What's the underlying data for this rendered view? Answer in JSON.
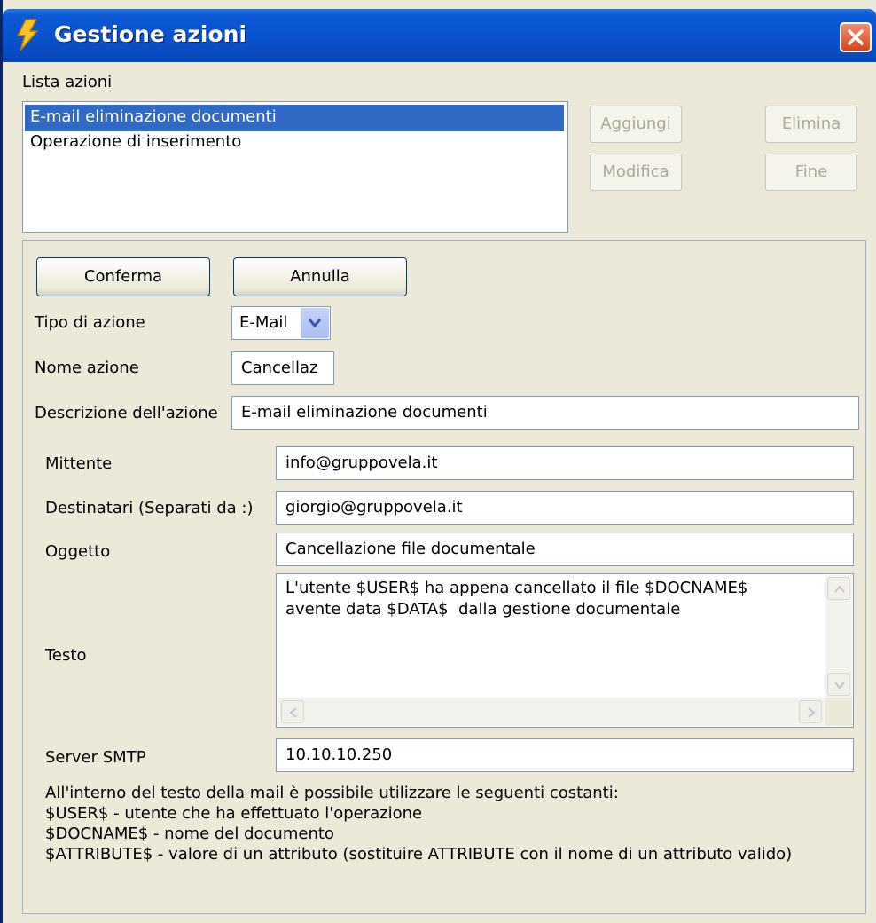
{
  "window": {
    "title": "Gestione azioni"
  },
  "actions_list": {
    "label": "Lista azioni",
    "items": [
      {
        "label": "E-mail eliminazione documenti",
        "selected": true
      },
      {
        "label": "Operazione di inserimento",
        "selected": false
      }
    ]
  },
  "list_buttons": {
    "add": "Aggiungi",
    "delete": "Elimina",
    "edit": "Modifica",
    "end": "Fine"
  },
  "form": {
    "confirm": "Conferma",
    "cancel": "Annulla",
    "action_type_label": "Tipo di azione",
    "action_type_value": "E-Mail",
    "action_name_label": "Nome azione",
    "action_name_value": "Cancellaz",
    "description_label": "Descrizione dell'azione",
    "description_value": "E-mail eliminazione documenti",
    "sender_label": "Mittente",
    "sender_value": "info@gruppovela.it",
    "recipients_label": "Destinatari (Separati da :)",
    "recipients_value": "giorgio@gruppovela.it",
    "subject_label": "Oggetto",
    "subject_value": "Cancellazione file documentale",
    "text_label": "Testo",
    "text_line1": "L'utente $USER$ ha appena cancellato il file $DOCNAME$",
    "text_line2": "avente data $DATA$  dalla gestione documentale",
    "smtp_label": "Server SMTP",
    "smtp_value": "10.10.10.250"
  },
  "info": {
    "line1": "All'interno del testo della mail è possibile utilizzare le seguenti costanti:",
    "line2": "$USER$ - utente che ha effettuato l'operazione",
    "line3": "$DOCNAME$ - nome del documento",
    "line4": "$ATTRIBUTE$ - valore di un attributo (sostituire ATTRIBUTE con il nome di un attributo valido)"
  },
  "colors": {
    "titlebar": "#0a52cf",
    "selection": "#316ac5",
    "window_bg": "#ece9d8",
    "close_button": "#d8421c"
  },
  "icons": {
    "app": "lightning-bolt-icon",
    "close": "close-icon",
    "dropdown": "chevron-down-icon"
  }
}
